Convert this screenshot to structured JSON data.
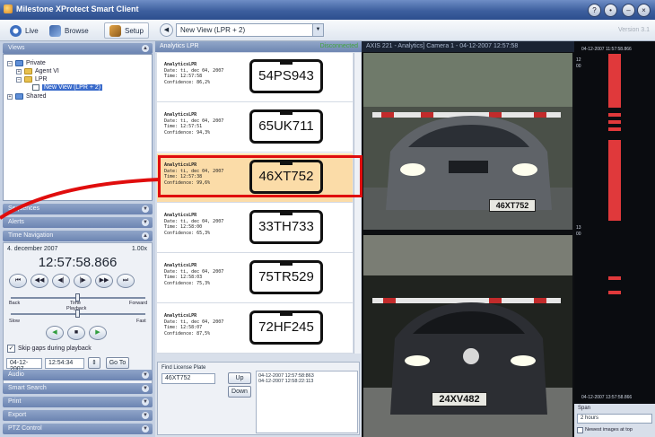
{
  "window": {
    "title": "Milestone XProtect Smart Client",
    "version": "Version 3.1"
  },
  "toolbar": {
    "live": "Live",
    "browse": "Browse",
    "setup": "Setup",
    "view_select": "New View (LPR + 2)"
  },
  "sidebar": {
    "views_header": "Views",
    "tree": {
      "private": "Private",
      "agent_vi": "Agent VI",
      "lpr": "LPR",
      "new_view": "New View (LPR + 2)",
      "shared": "Shared"
    },
    "sequences_header": "Sequences",
    "alerts_header": "Alerts",
    "time_nav_header": "Time Navigation",
    "time_nav": {
      "date": "4. december 2007",
      "speed": "1.00x",
      "time": "12:57:58.866",
      "back": "Back",
      "time_label": "Time",
      "forward": "Forward",
      "playback": "Playback",
      "slow": "Slow",
      "fast": "Fast",
      "skip_gaps": "Skip gaps during playback",
      "goto_date": "04-12-2007",
      "goto_time": "12:54:34",
      "goto_btn": "Go To"
    },
    "audio_header": "Audio",
    "smart_search_header": "Smart Search",
    "print_header": "Print",
    "export_header": "Export",
    "ptz_header": "PTZ Control"
  },
  "analytics": {
    "header": "Analytics LPR",
    "status": "Disconnected",
    "rows": [
      {
        "title": "AnalyticsLPR",
        "date": "Date: ti, dec 04, 2007",
        "time": "Time: 12:57:58",
        "confidence": "Confidence: 86,2%",
        "plate": "54PS943"
      },
      {
        "title": "AnalyticsLPR",
        "date": "Date: ti, dec 04, 2007",
        "time": "Time: 12:57:51",
        "confidence": "Confidence: 94,3%",
        "plate": "65UK711"
      },
      {
        "title": "AnalyticsLPR",
        "date": "Date: ti, dec 04, 2007",
        "time": "Time: 12:57:38",
        "confidence": "Confidence: 99,6%",
        "plate": "46XT752"
      },
      {
        "title": "AnalyticsLPR",
        "date": "Date: ti, dec 04, 2007",
        "time": "Time: 12:58:00",
        "confidence": "Confidence: 65,3%",
        "plate": "33TH733"
      },
      {
        "title": "AnalyticsLPR",
        "date": "Date: ti, dec 04, 2007",
        "time": "Time: 12:58:03",
        "confidence": "Confidence: 75,3%",
        "plate": "75TR529"
      },
      {
        "title": "AnalyticsLPR",
        "date": "Date: ti, dec 04, 2007",
        "time": "Time: 12:58:07",
        "confidence": "Confidence: 87,5%",
        "plate": "72HF245"
      }
    ],
    "find": {
      "label": "Find License Plate",
      "value": "46XT752",
      "up": "Up",
      "down": "Down",
      "results": [
        "04-12-2007 12:57:58:863",
        "04-12-2007 12:58:22:113"
      ]
    }
  },
  "camera": {
    "title": "AXIS 221 - Analytics] Camera 1 - 04-12-2007 12:57:58",
    "plate_top": "46XT752",
    "plate_bottom": "24XV482"
  },
  "timeline": {
    "top_stamp": "04-12-2007 11:57:58.866",
    "bottom_stamp": "04-12-2007 13:57:58.866",
    "span_label": "Span",
    "span_value": "2 hours",
    "newest_top": "Newest images at top",
    "tick_12": "12",
    "tick_00": "00",
    "tick_13": "13"
  }
}
